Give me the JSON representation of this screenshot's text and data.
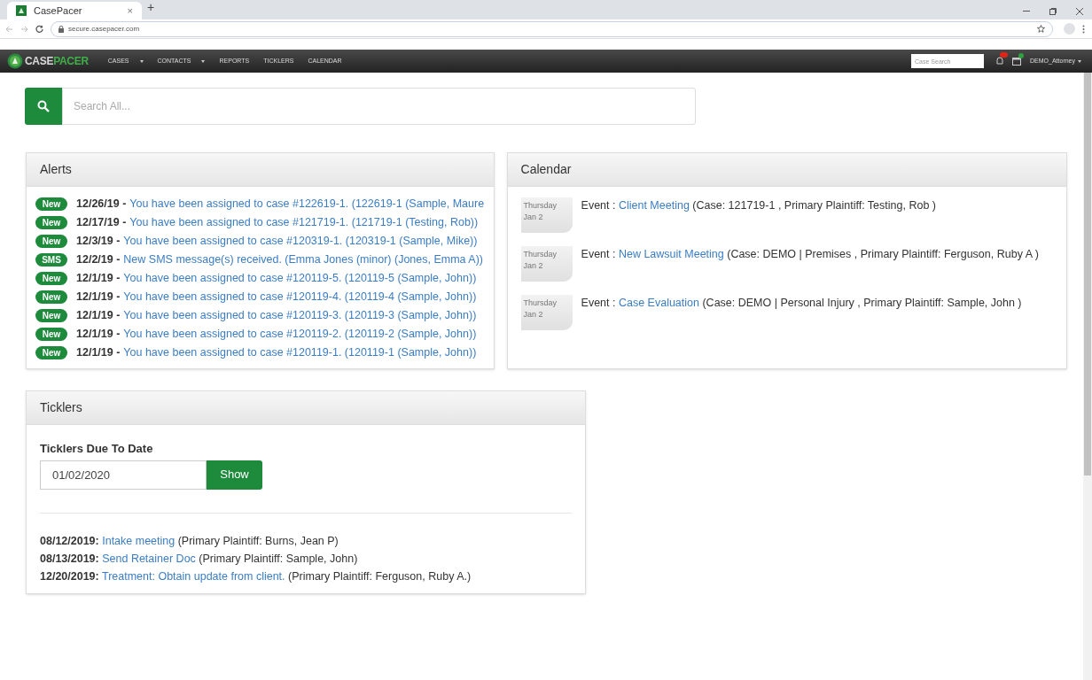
{
  "browser": {
    "tab_title": "CasePacer",
    "tab_close": "×",
    "new_tab": "+",
    "url": "secure.casepacer.com"
  },
  "navbar": {
    "logo": {
      "first": "CASE",
      "second": "PACER"
    },
    "items": [
      {
        "label": "CASES",
        "dropdown": true
      },
      {
        "label": "CONTACTS",
        "dropdown": true
      },
      {
        "label": "REPORTS",
        "dropdown": false
      },
      {
        "label": "TICKLERS",
        "dropdown": false
      },
      {
        "label": "CALENDAR",
        "dropdown": false
      }
    ],
    "case_search_placeholder": "Case Search",
    "user": "DEMO_Attorney"
  },
  "search": {
    "placeholder": "Search All..."
  },
  "alerts": {
    "title": "Alerts",
    "items": [
      {
        "badge": "New",
        "date": "12/26/19 -",
        "text": "You have been assigned to case #122619-1. (122619-1 (Sample, Maure"
      },
      {
        "badge": "New",
        "date": "12/17/19 -",
        "text": "You have been assigned to case #121719-1. (121719-1 (Testing, Rob))"
      },
      {
        "badge": "New",
        "date": "12/3/19 -",
        "text": "You have been assigned to case #120319-1. (120319-1 (Sample, Mike))"
      },
      {
        "badge": "SMS",
        "date": "12/2/19 -",
        "text": "New SMS message(s) received. (Emma Jones (minor) (Jones, Emma A))"
      },
      {
        "badge": "New",
        "date": "12/1/19 -",
        "text": "You have been assigned to case #120119-5. (120119-5 (Sample, John))"
      },
      {
        "badge": "New",
        "date": "12/1/19 -",
        "text": "You have been assigned to case #120119-4. (120119-4 (Sample, John))"
      },
      {
        "badge": "New",
        "date": "12/1/19 -",
        "text": "You have been assigned to case #120119-3. (120119-3 (Sample, John))"
      },
      {
        "badge": "New",
        "date": "12/1/19 -",
        "text": "You have been assigned to case #120119-2. (120119-2 (Sample, John))"
      },
      {
        "badge": "New",
        "date": "12/1/19 -",
        "text": "You have been assigned to case #120119-1. (120119-1 (Sample, John))"
      }
    ]
  },
  "calendar": {
    "title": "Calendar",
    "events": [
      {
        "day": "Thursday",
        "date": "Jan 2",
        "prefix": "Event :",
        "link": "Client Meeting",
        "details": "(Case: 121719-1 , Primary Plaintiff: Testing, Rob )"
      },
      {
        "day": "Thursday",
        "date": "Jan 2",
        "prefix": "Event :",
        "link": "New Lawsuit Meeting",
        "details": "(Case: DEMO | Premises , Primary Plaintiff: Ferguson, Ruby A )"
      },
      {
        "day": "Thursday",
        "date": "Jan 2",
        "prefix": "Event :",
        "link": "Case Evaluation",
        "details": "(Case: DEMO | Personal Injury , Primary Plaintiff: Sample, John )"
      }
    ]
  },
  "ticklers": {
    "title": "Ticklers",
    "due_label": "Ticklers Due To Date",
    "date_value": "01/02/2020",
    "show_button": "Show",
    "items": [
      {
        "date": "08/12/2019:",
        "link": "Intake meeting",
        "details": "(Primary Plaintiff: Burns, Jean P)"
      },
      {
        "date": "08/13/2019:",
        "link": "Send Retainer Doc",
        "details": "(Primary Plaintiff: Sample, John)"
      },
      {
        "date": "12/20/2019:",
        "link": "Treatment: Obtain update from client.",
        "details": "(Primary Plaintiff: Ferguson, Ruby A.)"
      }
    ]
  }
}
